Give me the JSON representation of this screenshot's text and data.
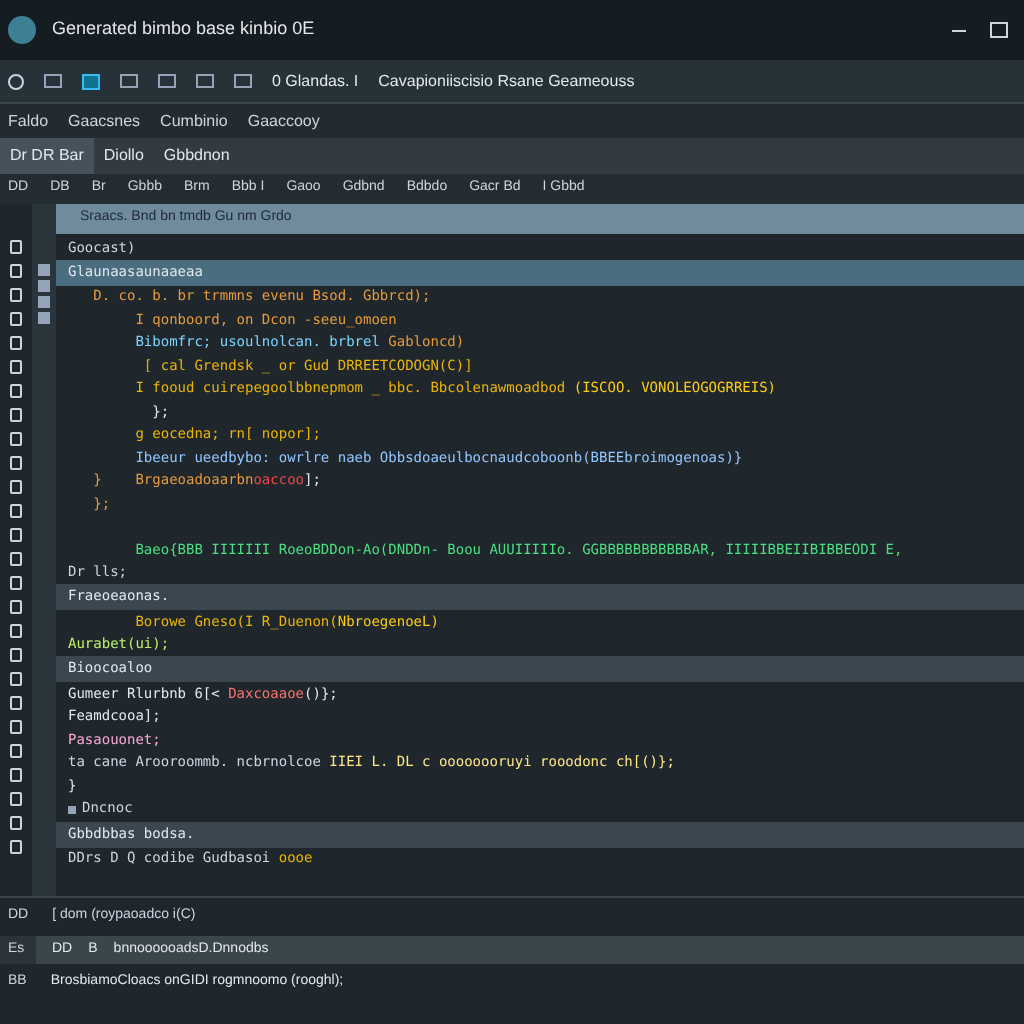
{
  "window": {
    "title": "Generated bimbo base kinbio 0E"
  },
  "toolbar": {
    "items": [
      "0 Glandas. I",
      "Cavapioniiscisio Rsane Geameouss"
    ]
  },
  "menu": [
    "Faldo",
    "Gaacsnes",
    "Cumbinio",
    "Gaaccooy"
  ],
  "tabs": [
    {
      "label": "Dr DR Bar",
      "selected": true
    },
    {
      "label": "Diollo",
      "selected": false
    },
    {
      "label": "Gbbdnon",
      "selected": false
    }
  ],
  "submenu": [
    "DD",
    "DB",
    "Br",
    "Gbbb",
    "Brm",
    "Bbb I",
    "Gaoo",
    "Gdbnd",
    "Bdbdo",
    "Gacr Bd",
    "I Gbbd"
  ],
  "editor": {
    "path": "Sraacs. Bnd bn tmdb Gu nm Grdo",
    "lines": [
      {
        "kind": "code",
        "tokens": [
          {
            "text": "Goocast)",
            "color": "#cbd5e1"
          }
        ]
      },
      {
        "kind": "band",
        "tokens": [
          {
            "text": "Glaunaasaunaaeaa",
            "color": "#e2e8f0"
          }
        ]
      },
      {
        "kind": "code",
        "tokens": [
          {
            "text": "   D. co. b. br trmmns evenu Bsod. Gbbrcd);",
            "color": "#e59a3c"
          }
        ]
      },
      {
        "kind": "code",
        "tokens": [
          {
            "text": "        I qonboord, on Dcon -seeu_omoen",
            "color": "#e59a3c"
          }
        ]
      },
      {
        "kind": "code",
        "tokens": [
          {
            "text": "        Bibomfrc; usoulnolcan. brbrel ",
            "color": "#7dd3fc"
          },
          {
            "text": "Gabloncd)",
            "color": "#e59a3c"
          }
        ]
      },
      {
        "kind": "code",
        "tokens": [
          {
            "text": "         [ cal Grendsk _ or Gud DRREETCODOGN(C)]",
            "color": "#eab308"
          }
        ]
      },
      {
        "kind": "code",
        "tokens": [
          {
            "text": "        I fooud cuirepegoolbbnepmom _ bbc. Bbcolenawmoadbod ",
            "color": "#eab308"
          },
          {
            "text": "(ISCOO. VONOLEOGOGRREIS)",
            "color": "#facc15"
          }
        ]
      },
      {
        "kind": "code",
        "tokens": [
          {
            "text": "          };",
            "color": "#e2e8f0"
          }
        ]
      },
      {
        "kind": "code",
        "tokens": [
          {
            "text": "        g eocedna; rn[ nopor];",
            "color": "#eab308"
          }
        ]
      },
      {
        "kind": "code",
        "tokens": [
          {
            "text": "        Ibeeur ueedbybo: owrlre naeb Obbsdoaeulbocnaudcoboonb(BBEEbroimogenoas)}",
            "color": "#93c5fd"
          }
        ]
      },
      {
        "kind": "code",
        "tokens": [
          {
            "text": "   }    Brgaeoadoaarbn",
            "color": "#e59a3c"
          },
          {
            "text": "oaccoo",
            "color": "#ef4444"
          },
          {
            "text": "];",
            "color": "#e2e8f0"
          }
        ]
      },
      {
        "kind": "code",
        "tokens": [
          {
            "text": "   };",
            "color": "#e59a3c"
          }
        ]
      },
      {
        "kind": "blank"
      },
      {
        "kind": "code",
        "tokens": [
          {
            "text": "        Baeo{BBB IIIIIII RoeoBDDon-Ao(DNDDn- Boou AUUIIIIIo. GGBBBBBBBBBBBAR, IIIIIBBEIIBIBBEODI E,",
            "color": "#4ade80"
          }
        ]
      },
      {
        "kind": "code",
        "tokens": [
          {
            "text": "Dr lls;",
            "color": "#cbd5e1"
          }
        ]
      },
      {
        "kind": "band",
        "tokens": [
          {
            "text": "Fraeoeaonas.",
            "color": "#e2e8f0"
          }
        ]
      },
      {
        "kind": "code",
        "tokens": [
          {
            "text": "        Borowe Gneso(I R_Duenon(",
            "color": "#eab308"
          },
          {
            "text": "NbroegenoeL)",
            "color": "#facc15"
          }
        ]
      },
      {
        "kind": "code",
        "tokens": [
          {
            "text": "Aurabet(ui);",
            "color": "#bef264"
          }
        ]
      },
      {
        "kind": "band",
        "tokens": [
          {
            "text": "Bioocoaloo",
            "color": "#e2e8f0"
          }
        ]
      },
      {
        "kind": "code",
        "tokens": [
          {
            "text": "Gumeer Rlurbnb 6[< ",
            "color": "#e2e8f0"
          },
          {
            "text": "Daxcoaaoe",
            "color": "#f87171"
          },
          {
            "text": "()};",
            "color": "#e2e8f0"
          }
        ]
      },
      {
        "kind": "code",
        "tokens": [
          {
            "text": "Feamdcooa];",
            "color": "#e2e8f0"
          }
        ]
      },
      {
        "kind": "code",
        "tokens": [
          {
            "text": "Pasaouonet;",
            "color": "#f9a8d4"
          }
        ]
      },
      {
        "kind": "code",
        "tokens": [
          {
            "text": "ta cane Arooroommb. ncbrnolcoe ",
            "color": "#cbd5e1"
          },
          {
            "text": "IIEI L. DL c oooooooruyi rooodonc ch[()};",
            "color": "#fde68a"
          }
        ]
      },
      {
        "kind": "code",
        "tokens": [
          {
            "text": "}",
            "color": "#e2e8f0"
          }
        ]
      },
      {
        "kind": "heading",
        "tokens": [
          {
            "text": "Dncnoc",
            "color": "#cbd5e1"
          }
        ]
      },
      {
        "kind": "band",
        "tokens": [
          {
            "text": "Gbbdbbas bodsa.",
            "color": "#e2e8f0"
          }
        ]
      },
      {
        "kind": "code",
        "tokens": [
          {
            "text": "DDrs D Q codibe Gudbasoi ",
            "color": "#cbd5e1"
          },
          {
            "text": "oooe",
            "color": "#eab308"
          }
        ]
      }
    ]
  },
  "console": {
    "prompt": "DD",
    "line": "[ dom (roypaoadco i(C)"
  },
  "output": {
    "tab_label": "Es",
    "header": [
      "DD",
      "B"
    ],
    "header_text": "bnnoooooadsD.Dnnodbs",
    "row_label": "BB",
    "row_text": "BrosbiamoCloacs onGIDI rogmnoomo (rooghl);"
  }
}
